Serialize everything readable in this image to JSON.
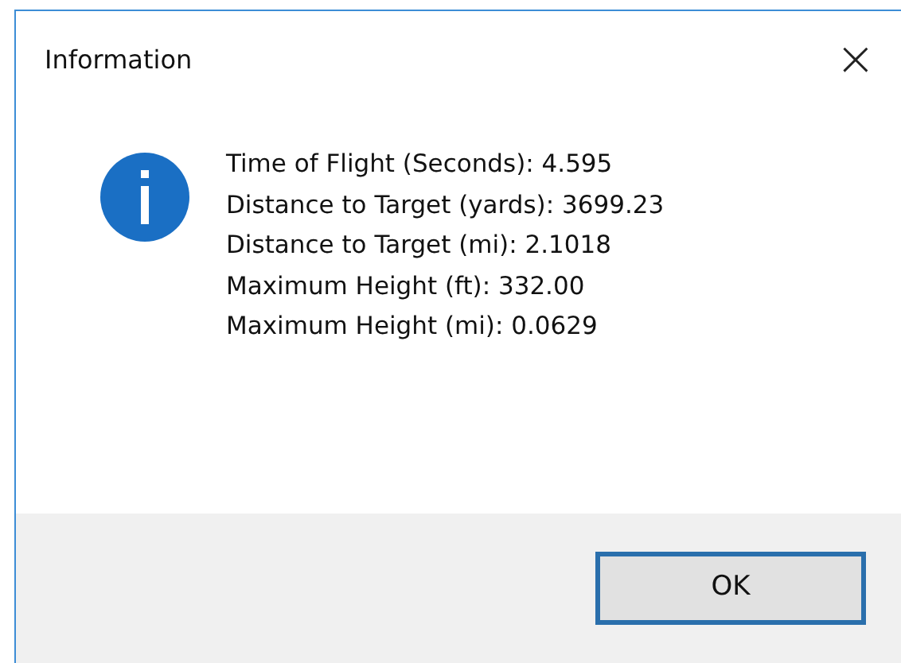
{
  "window": {
    "title": "Information",
    "close": "×"
  },
  "message": {
    "lines": [
      "Time of Flight (Seconds): 4.595",
      "Distance to Target (yards): 3699.23",
      "Distance to Target (mi): 2.1018",
      "Maximum Height (ft): 332.00",
      "Maximum Height (mi): 0.0629"
    ]
  },
  "buttons": [
    {
      "label": "OK",
      "default": true
    }
  ]
}
